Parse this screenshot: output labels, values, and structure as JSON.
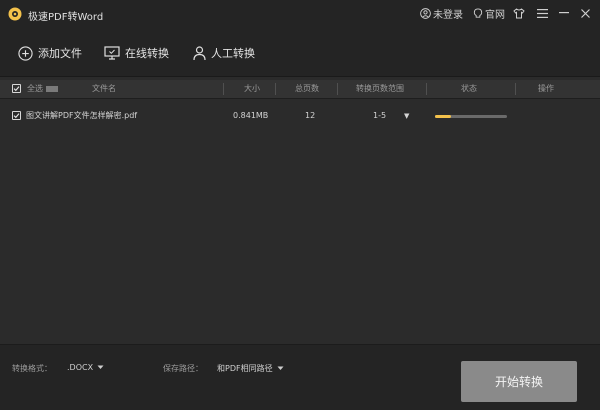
{
  "app": {
    "title": "极速PDF转Word"
  },
  "titlebar": {
    "login_label": "未登录",
    "website_label": "官网"
  },
  "toolbar": {
    "add_file_label": "添加文件",
    "online_convert_label": "在线转换",
    "manual_convert_label": "人工转换"
  },
  "table": {
    "select_all_label": "全选",
    "headers": {
      "filename": "文件名",
      "size": "大小",
      "pages": "总页数",
      "page_range": "转换页数范围",
      "status": "状态",
      "actions": "操作"
    },
    "rows": [
      {
        "checked": true,
        "filename": "图文讲解PDF文件怎样解密.pdf",
        "size": "0.841MB",
        "pages": "12",
        "page_range": "1-5",
        "progress": 0.22
      }
    ]
  },
  "footer": {
    "format_label": "转换格式：",
    "format_value": ".DOCX",
    "save_path_label": "保存路径：",
    "save_path_value": "和PDF相同路径",
    "start_button_label": "开始转换"
  },
  "colors": {
    "background": "#2b2b2b",
    "bar": "#242424",
    "logo": "#f3c14b",
    "progress": "#f3c14b",
    "start_button": "#8a8a8a"
  }
}
